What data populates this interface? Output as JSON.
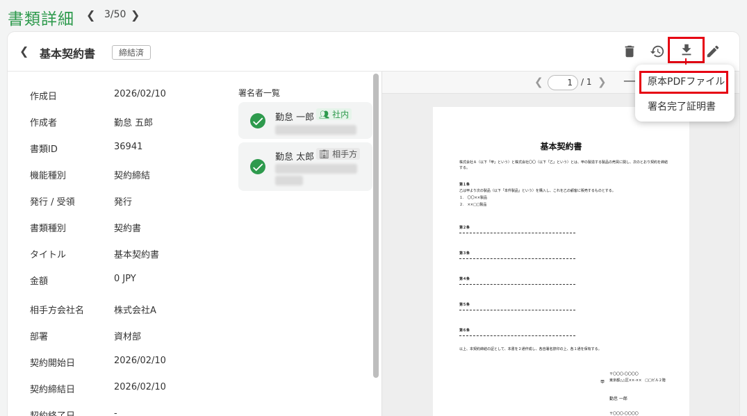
{
  "page": {
    "title": "書類詳細",
    "pager": "3/50"
  },
  "document": {
    "title": "基本契約書",
    "status": "締結済"
  },
  "info": [
    {
      "label": "作成日",
      "value": "2026/02/10"
    },
    {
      "label": "作成者",
      "value": "勤怠 五郎"
    },
    {
      "label": "書類ID",
      "value": "36941"
    },
    {
      "label": "機能種別",
      "value": "契約締結"
    },
    {
      "label": "発行 / 受領",
      "value": "発行"
    },
    {
      "label": "書類種別",
      "value": "契約書"
    },
    {
      "label": "タイトル",
      "value": "基本契約書"
    },
    {
      "label": "金額",
      "value": "0 JPY"
    },
    {
      "label": "相手方会社名",
      "value": "株式会社A"
    },
    {
      "label": "部署",
      "value": "資材部"
    },
    {
      "label": "契約開始日",
      "value": "2026/02/10"
    },
    {
      "label": "契約締結日",
      "value": "2026/02/10"
    },
    {
      "label": "契約終了日",
      "value": "-"
    }
  ],
  "signers": {
    "title": "署名者一覧",
    "items": [
      {
        "name": "勤怠 一郎",
        "tag": "社内"
      },
      {
        "name": "勤怠 太郎",
        "tag": "相手方"
      }
    ]
  },
  "viewer": {
    "page_value": "1",
    "page_total": "/ 1"
  },
  "pdf": {
    "title": "基本契約書",
    "intro": "株式会社Ａ（以下「甲」という）と株式会社〇〇（以下「乙」という）とは、甲の製造する製品の売買に関し、次のとおり契約を締結する。",
    "art1_head": "第１条",
    "art1_text": "乙は甲より次の製品（以下「本件製品」という）を購入し、これを乙の顧客に販売するものとする。",
    "art1_item1": "１.　〇〇××製品",
    "art1_item2": "２.　××□□製品",
    "art2": "第２条",
    "art3": "第３条",
    "art4": "第４条",
    "art5": "第５条",
    "art6": "第６条",
    "closing": "以上、本契約締結の証として、本書を２通作成し、各自署名捺印の上、各１通を保有する。",
    "addr1": "〒〇〇〇-〇〇〇〇",
    "addr2": "東京都△△区××-××　□□ビル２階",
    "mark": "甲",
    "signer": "勤怠 一郎",
    "addr3": "〒〇〇〇-〇〇〇〇"
  },
  "dropdown": {
    "items": [
      "原本PDFファイル",
      "署名完了証明書"
    ]
  },
  "colors": {
    "brand_green": "#2e9a4d",
    "highlight_red": "#e60012"
  }
}
